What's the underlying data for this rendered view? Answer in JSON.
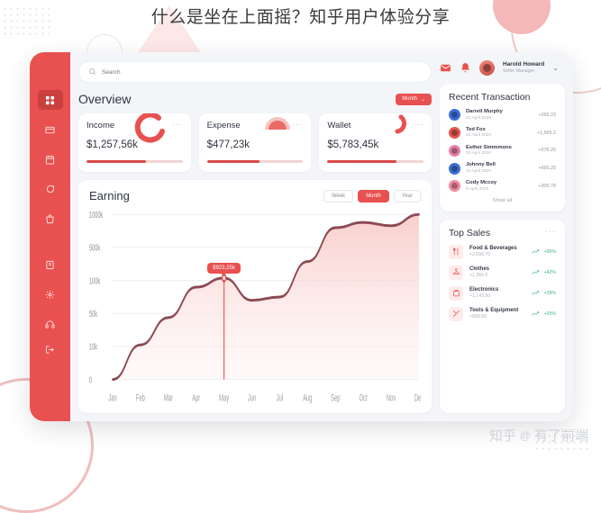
{
  "page": {
    "heading": "什么是坐在上面摇？知乎用户体验分享",
    "watermark_left": "知乎",
    "watermark_at": "@",
    "watermark_right": "有了前端"
  },
  "colors": {
    "accent": "#e8514f",
    "accent_dark": "#c9403e",
    "panel_bg": "#f4f5f8",
    "positive": "#3fb27f",
    "bar_track": "#f3d3d2"
  },
  "sidebar": {
    "items": [
      {
        "name": "dashboard",
        "icon": "grid-icon",
        "active": true
      },
      {
        "name": "cards",
        "icon": "card-icon",
        "active": false
      },
      {
        "name": "calendar",
        "icon": "calendar-icon",
        "active": false
      },
      {
        "name": "messages",
        "icon": "chat-icon",
        "active": false
      },
      {
        "name": "shop",
        "icon": "bag-icon",
        "active": false
      },
      {
        "name": "reports",
        "icon": "book-icon",
        "active": false
      },
      {
        "name": "settings",
        "icon": "gear-icon",
        "active": false
      },
      {
        "name": "support",
        "icon": "headset-icon",
        "active": false
      },
      {
        "name": "logout",
        "icon": "logout-icon",
        "active": false
      }
    ]
  },
  "topbar": {
    "search_placeholder": "Search",
    "search_value": "",
    "mail_icon": "mail-icon",
    "bell_icon": "bell-icon",
    "user_name": "Harold Howard",
    "user_role": "Seller Manager",
    "chevron": "⌄"
  },
  "overview": {
    "title": "Overview",
    "period_label": "Month",
    "period_chevron": "⌄",
    "cards": [
      {
        "label": "Income",
        "value": "$1,257,56k",
        "menu": "···",
        "progress": 62,
        "deco": "arc-open"
      },
      {
        "label": "Expense",
        "value": "$477,23k",
        "menu": "···",
        "progress": 55,
        "deco": "arc-half"
      },
      {
        "label": "Wallet",
        "value": "$5,783,45k",
        "menu": "···",
        "progress": 72,
        "deco": "arc-small"
      }
    ]
  },
  "earning": {
    "title": "Earning",
    "tabs": [
      {
        "label": "Week",
        "active": false
      },
      {
        "label": "Month",
        "active": true
      },
      {
        "label": "Year",
        "active": false
      }
    ],
    "tooltip": "$923,25k"
  },
  "chart_data": {
    "type": "area",
    "title": "Earning",
    "xlabel": "",
    "ylabel": "",
    "grid": true,
    "legend_position": "none",
    "categories": [
      "Jan",
      "Feb",
      "Mar",
      "Apr",
      "May",
      "Jun",
      "Jul",
      "Aug",
      "Sep",
      "Oct",
      "Nov",
      "Dec"
    ],
    "ytick_labels": [
      "1000k",
      "500k",
      "100k",
      "50k",
      "10k",
      "0"
    ],
    "ytick_values": [
      1000,
      500,
      100,
      50,
      10,
      0
    ],
    "series": [
      {
        "name": "Earning",
        "values": [
          0,
          12,
          45,
          90,
          130,
          70,
          75,
          330,
          800,
          880,
          830,
          1000
        ]
      }
    ],
    "annotations": [
      {
        "label": "$923,25k",
        "x": "May",
        "value": 130
      }
    ]
  },
  "transactions": {
    "title": "Recent Transaction",
    "show_all_label": "Show all",
    "rows": [
      {
        "name": "Darrell Murphy",
        "date": "23 April 2020",
        "amount": "+265.23",
        "avatar_color": "#3b6fd4"
      },
      {
        "name": "Ted Fox",
        "date": "23 April 2020",
        "amount": "+1,565.2",
        "avatar_color": "#e0574f"
      },
      {
        "name": "Esther Simmmons",
        "date": "15 April 2020",
        "amount": "+576.25",
        "avatar_color": "#e87fa8"
      },
      {
        "name": "Johnny Bell",
        "date": "12 April 2020",
        "amount": "+665.29",
        "avatar_color": "#3b6fd4"
      },
      {
        "name": "Cody Mccoy",
        "date": "9 April 2020",
        "amount": "+309.78",
        "avatar_color": "#f08aa0"
      }
    ]
  },
  "top_sales": {
    "title": "Top Sales",
    "menu": "···",
    "rows": [
      {
        "name": "Food & Beverages",
        "amount": "+2,658.70",
        "pct": "+56%",
        "icon": "cutlery-icon"
      },
      {
        "name": "Clothes",
        "amount": "+1,356.0",
        "pct": "+42%",
        "icon": "hanger-icon"
      },
      {
        "name": "Electronics",
        "amount": "+1,143.90",
        "pct": "+39%",
        "icon": "toolbox-icon"
      },
      {
        "name": "Tools & Equipment",
        "amount": "+898.80",
        "pct": "+25%",
        "icon": "tools-icon"
      }
    ]
  }
}
